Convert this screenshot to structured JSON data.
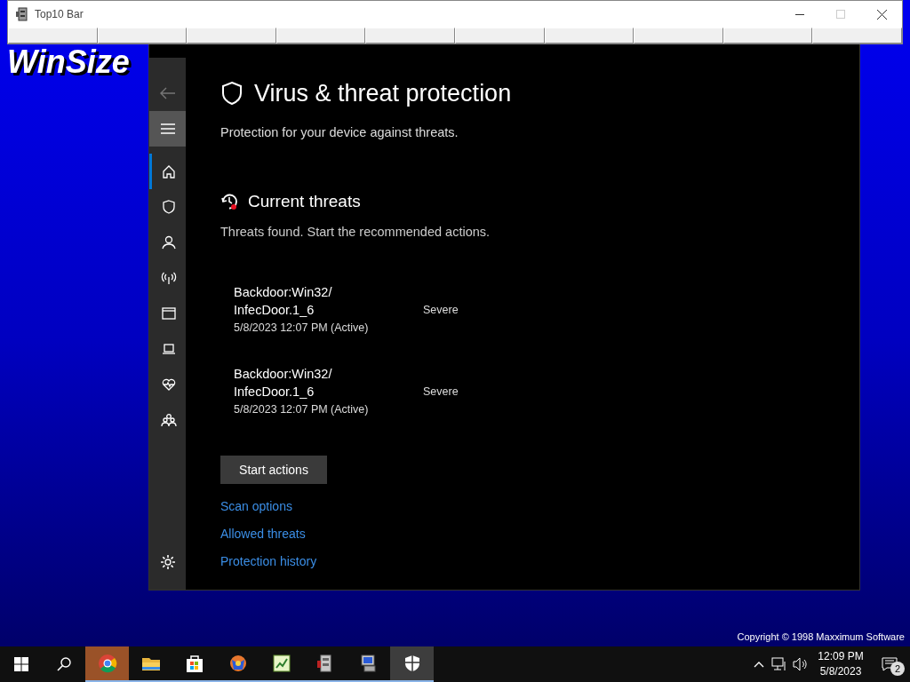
{
  "desktop": {
    "logo_text": "WinSize",
    "copyright": "Copyright © 1998 Maxximum Software"
  },
  "top_bar": {
    "title": "Top10 Bar",
    "slots": [
      {
        "selected": false
      },
      {
        "selected": false
      },
      {
        "selected": false
      },
      {
        "selected": false
      },
      {
        "selected": false
      },
      {
        "selected": false
      },
      {
        "selected": false
      },
      {
        "selected": false
      },
      {
        "selected": false
      },
      {
        "selected": false
      }
    ]
  },
  "security": {
    "title": "Virus & threat protection",
    "subtitle": "Protection for your device against threats.",
    "nav": [
      {
        "kind": "home",
        "selected": true
      },
      {
        "kind": "shield",
        "selected": false
      },
      {
        "kind": "person",
        "selected": false
      },
      {
        "kind": "wireless",
        "selected": false
      },
      {
        "kind": "window",
        "selected": false
      },
      {
        "kind": "laptop",
        "selected": false
      },
      {
        "kind": "heart",
        "selected": false
      },
      {
        "kind": "family",
        "selected": false
      }
    ],
    "section_title": "Current threats",
    "section_text": "Threats found. Start the recommended actions.",
    "threats": [
      {
        "name": "Backdoor:Win32/\nInfecDoor.1_6",
        "time": "5/8/2023 12:07 PM (Active)",
        "severity": "Severe"
      },
      {
        "name": "Backdoor:Win32/\nInfecDoor.1_6",
        "time": "5/8/2023 12:07 PM (Active)",
        "severity": "Severe"
      }
    ],
    "action_button": "Start actions",
    "links": [
      "Scan options",
      "Allowed threats",
      "Protection history"
    ]
  },
  "taskbar": {
    "apps": [
      {
        "kind": "chrome",
        "selected": false,
        "running": true,
        "flashing": true
      },
      {
        "kind": "folder",
        "selected": false,
        "running": true
      },
      {
        "kind": "store",
        "selected": false,
        "running": true
      },
      {
        "kind": "globe",
        "selected": false,
        "running": true
      },
      {
        "kind": "chart",
        "selected": false,
        "running": true
      },
      {
        "kind": "cabinet",
        "selected": false,
        "running": true
      },
      {
        "kind": "computer",
        "selected": false,
        "running": true
      },
      {
        "kind": "shield",
        "selected": true,
        "running": true
      }
    ],
    "time": "12:09 PM",
    "date": "5/8/2023",
    "notifications": "2"
  }
}
